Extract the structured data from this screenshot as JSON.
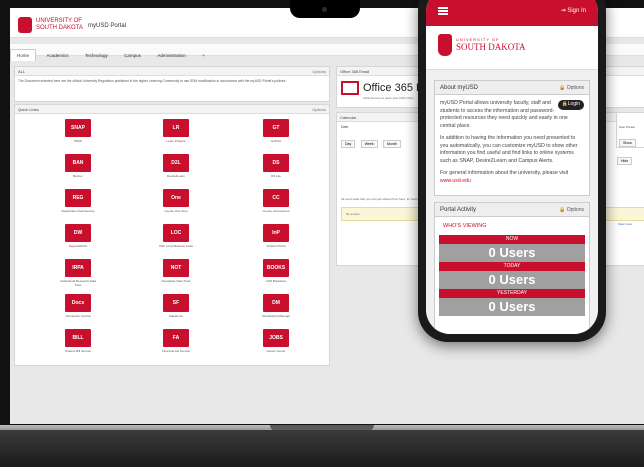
{
  "portal": {
    "logo_line1": "UNIVERSITY OF",
    "logo_line2": "SOUTH DAKOTA",
    "name": "myUSD Portal"
  },
  "nav": {
    "tabs": [
      "Home",
      "Academics",
      "Technology",
      "Campus",
      "Administration",
      "+"
    ]
  },
  "left": {
    "notice_title": "ALL",
    "notice_options": "Options",
    "notice_text": "The Document selected here are the official University Regulation published in the higher Learning Community to use SSM modification in accordance with the myUSD Portal's policies.",
    "quick_title": "Quick Links",
    "quick_options": "Options",
    "tiles": [
      {
        "abbr": "SNAP",
        "caption": "SNAP"
      },
      {
        "abbr": "LR",
        "caption": "Learn Prepare"
      },
      {
        "abbr": "GT",
        "caption": "GoPrint"
      },
      {
        "abbr": "BAN",
        "caption": "Banner"
      },
      {
        "abbr": "D2L",
        "caption": "Desire2Learn"
      },
      {
        "abbr": "DS",
        "caption": "DS Lite"
      },
      {
        "abbr": "REG",
        "caption": "Registration Self-Service"
      },
      {
        "abbr": "One",
        "caption": "Coyote One Stop"
      },
      {
        "abbr": "CC",
        "caption": "Coyote Connections"
      },
      {
        "abbr": "DW",
        "caption": "DegreeWorks"
      },
      {
        "abbr": "LOC",
        "caption": "USF Loop Distance Code"
      },
      {
        "abbr": "InP",
        "caption": "Intranet Portal"
      },
      {
        "abbr": "IRPA",
        "caption": "Institutional Research Data Tools"
      },
      {
        "abbr": "NOT",
        "caption": "Newsletter Data Tools"
      },
      {
        "abbr": "BOOKS",
        "caption": "USD Bookstore"
      },
      {
        "abbr": "Docs",
        "caption": "Perception Central"
      },
      {
        "abbr": "SF",
        "caption": "Salesforce"
      },
      {
        "abbr": "DM",
        "caption": "Scholarship Manager"
      },
      {
        "abbr": "BILL",
        "caption": "Student Bill Service"
      },
      {
        "abbr": "FA",
        "caption": "Financial Aid Service"
      },
      {
        "abbr": "JOBS",
        "caption": "Career Center"
      }
    ]
  },
  "right": {
    "email_title": "Office 365 Email",
    "email_heading": "Office 365 Emai",
    "email_sub": "Click the icon to open your USD inbox",
    "cal_title": "Calendar",
    "cal_label": "Date",
    "cal_buttons": [
      "Day",
      "Week",
      "Month"
    ],
    "cal_note": "All event data that you can get shared from here, for bounded accounts",
    "cal_no_events": "No events",
    "user_panel": "User Preset",
    "user_buttons": [
      "Show",
      "Hide"
    ],
    "view_more": "View more"
  },
  "phone": {
    "signin": "Sign In",
    "logo_small": "UNIVERSITY OF",
    "logo_big": "SOUTH DAKOTA",
    "about_title": "About myUSD",
    "about_options": "Options",
    "about_p1": "myUSD Portal allows university faculty, staff and students to access the information and password-protected resources they need quickly and easily in one central place.",
    "login_label": "Login",
    "about_p2": "In addition to having the information you need presented to you automatically, you can customize myUSD to show other information you find useful and find links to online systems such as SNAP, Desire2Learn and Campus Alerts.",
    "about_p3_prefix": "For general information about the university, please visit",
    "about_link": "www.usd.edu",
    "activity_title": "Portal Activity",
    "activity_options": "Options",
    "whos_viewing": "WHO'S VIEWING",
    "stats": [
      {
        "label": "NOW",
        "value": "0 Users"
      },
      {
        "label": "TODAY",
        "value": "0 Users"
      },
      {
        "label": "YESTERDAY",
        "value": "0 Users"
      }
    ]
  },
  "colors": {
    "brand_red": "#c8102e",
    "stat_gray": "#a0a0a0"
  }
}
